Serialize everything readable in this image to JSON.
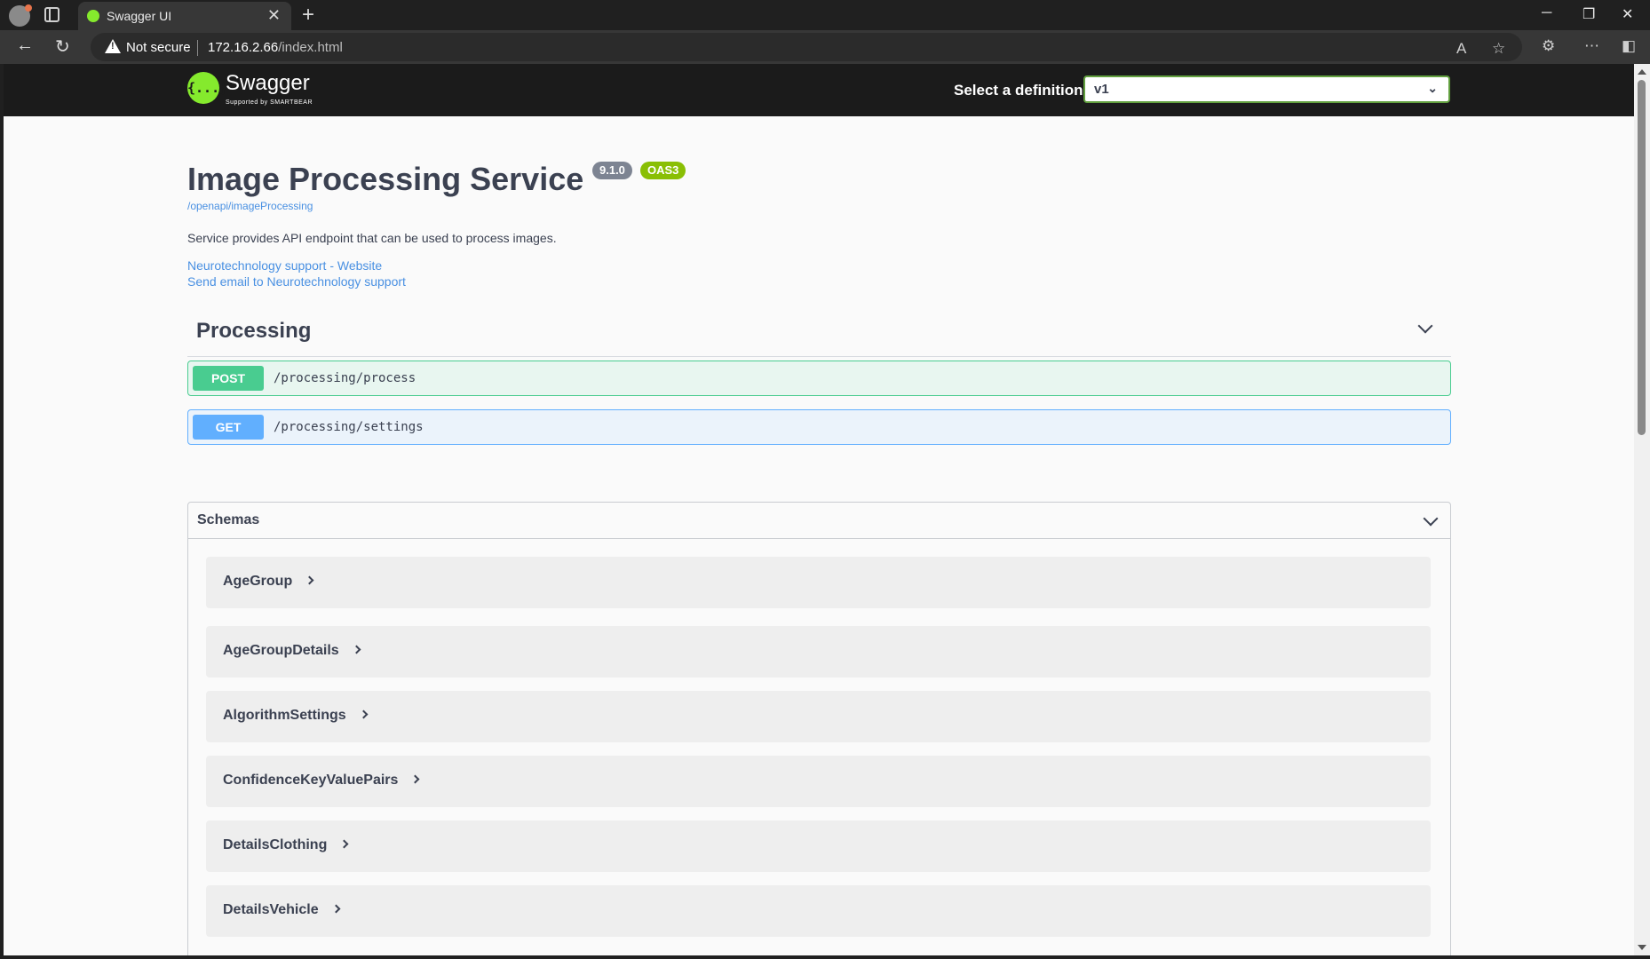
{
  "browser": {
    "tab_title": "Swagger UI",
    "security_label": "Not secure",
    "url_host": "172.16.2.66",
    "url_path": "/index.html"
  },
  "topbar": {
    "logo_symbol": "{...}",
    "logo_text": "Swagger",
    "logo_subtext": "Supported by SMARTBEAR",
    "definition_label": "Select a definition",
    "definition_value": "v1"
  },
  "info": {
    "title": "Image Processing Service",
    "version": "9.1.0",
    "oas_badge": "OAS3",
    "spec_url": "/openapi/imageProcessing",
    "description": "Service provides API endpoint that can be used to process images.",
    "website_link": "Neurotechnology support - Website",
    "email_link": "Send email to Neurotechnology support"
  },
  "tag": {
    "name": "Processing",
    "operations": [
      {
        "method": "POST",
        "path": "/processing/process",
        "color": "#49cc90"
      },
      {
        "method": "GET",
        "path": "/processing/settings",
        "color": "#61affe"
      }
    ]
  },
  "schemas": {
    "title": "Schemas",
    "models": [
      "AgeGroup",
      "AgeGroupDetails",
      "AlgorithmSettings",
      "ConfidenceKeyValuePairs",
      "DetailsClothing",
      "DetailsVehicle"
    ]
  },
  "colors": {
    "brand": "#85ea2d",
    "post": "#49cc90",
    "get": "#61affe",
    "link": "#4990e2"
  }
}
